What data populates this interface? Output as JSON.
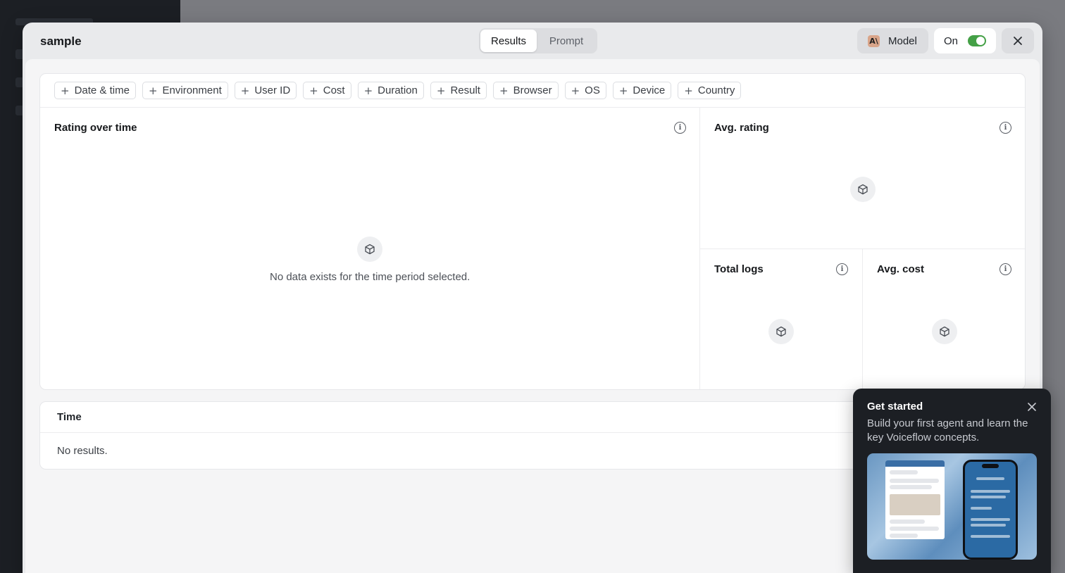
{
  "modal": {
    "title": "sample",
    "tabs": [
      {
        "label": "Results"
      },
      {
        "label": "Prompt"
      }
    ],
    "model_button": {
      "label": "Model",
      "logo_glyph": "A\\"
    },
    "status_toggle": {
      "label": "On",
      "state": "on",
      "color": "#44a046"
    }
  },
  "filters": [
    {
      "label": "Date & time"
    },
    {
      "label": "Environment"
    },
    {
      "label": "User ID"
    },
    {
      "label": "Cost"
    },
    {
      "label": "Duration"
    },
    {
      "label": "Result"
    },
    {
      "label": "Browser"
    },
    {
      "label": "OS"
    },
    {
      "label": "Device"
    },
    {
      "label": "Country"
    }
  ],
  "panels": {
    "rating_over_time": {
      "title": "Rating over time",
      "empty_message": "No data exists for the time period selected."
    },
    "avg_rating": {
      "title": "Avg. rating"
    },
    "total_logs": {
      "title": "Total logs"
    },
    "avg_cost": {
      "title": "Avg. cost"
    }
  },
  "table": {
    "columns": [
      "Time"
    ],
    "empty_message": "No results."
  },
  "get_started": {
    "title": "Get started",
    "description": "Build your first agent and learn the key Voiceflow concepts."
  },
  "icons": {
    "info": "info-icon",
    "empty": "cube-icon",
    "close": "close-icon",
    "plus": "plus-icon"
  }
}
